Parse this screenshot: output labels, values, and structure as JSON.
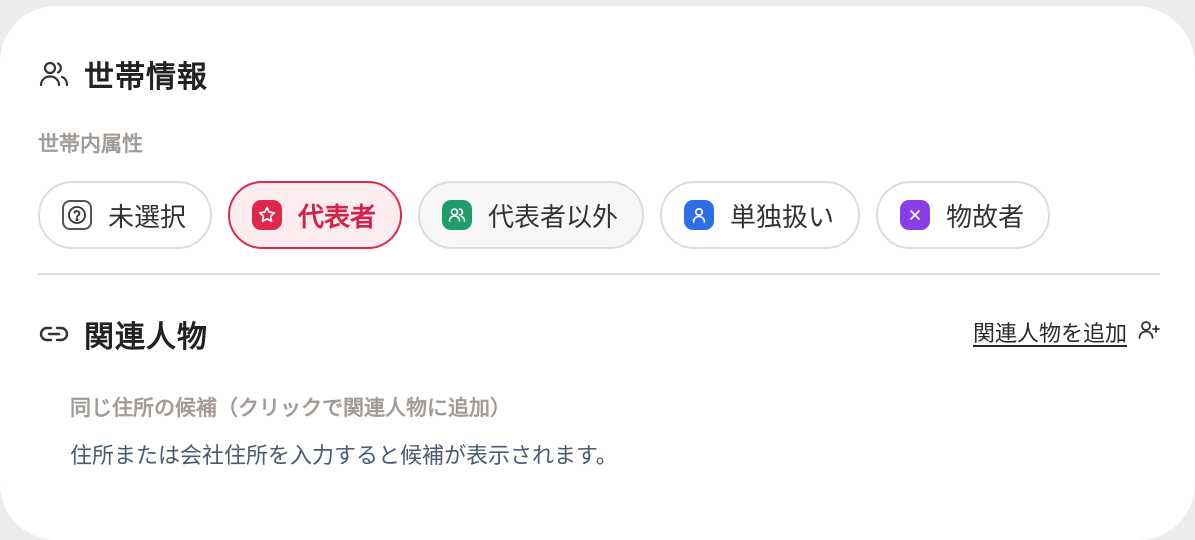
{
  "household": {
    "title": "世帯情報",
    "icon": "users-icon",
    "attribute_label": "世帯内属性",
    "options": [
      {
        "label": "未選択",
        "icon": "question-icon",
        "color": "#ffffff",
        "selected": false
      },
      {
        "label": "代表者",
        "icon": "star-icon",
        "color": "#e0284f",
        "selected": true
      },
      {
        "label": "代表者以外",
        "icon": "users-icon",
        "color": "#1e9c6a",
        "selected": false
      },
      {
        "label": "単独扱い",
        "icon": "user-icon",
        "color": "#2f6fe6",
        "selected": false
      },
      {
        "label": "物故者",
        "icon": "close-icon",
        "color": "#8b3ee6",
        "selected": false
      }
    ]
  },
  "related": {
    "title": "関連人物",
    "icon": "link-icon",
    "add_label": "関連人物を追加",
    "add_icon": "user-plus-icon",
    "candidates_label": "同じ住所の候補（クリックで関連人物に追加）",
    "empty_message": "住所または会社住所を入力すると候補が表示されます。"
  },
  "colors": {
    "accent": "#dc2b4e",
    "muted_label": "#a29c98",
    "helper_text": "#4a5a70"
  }
}
